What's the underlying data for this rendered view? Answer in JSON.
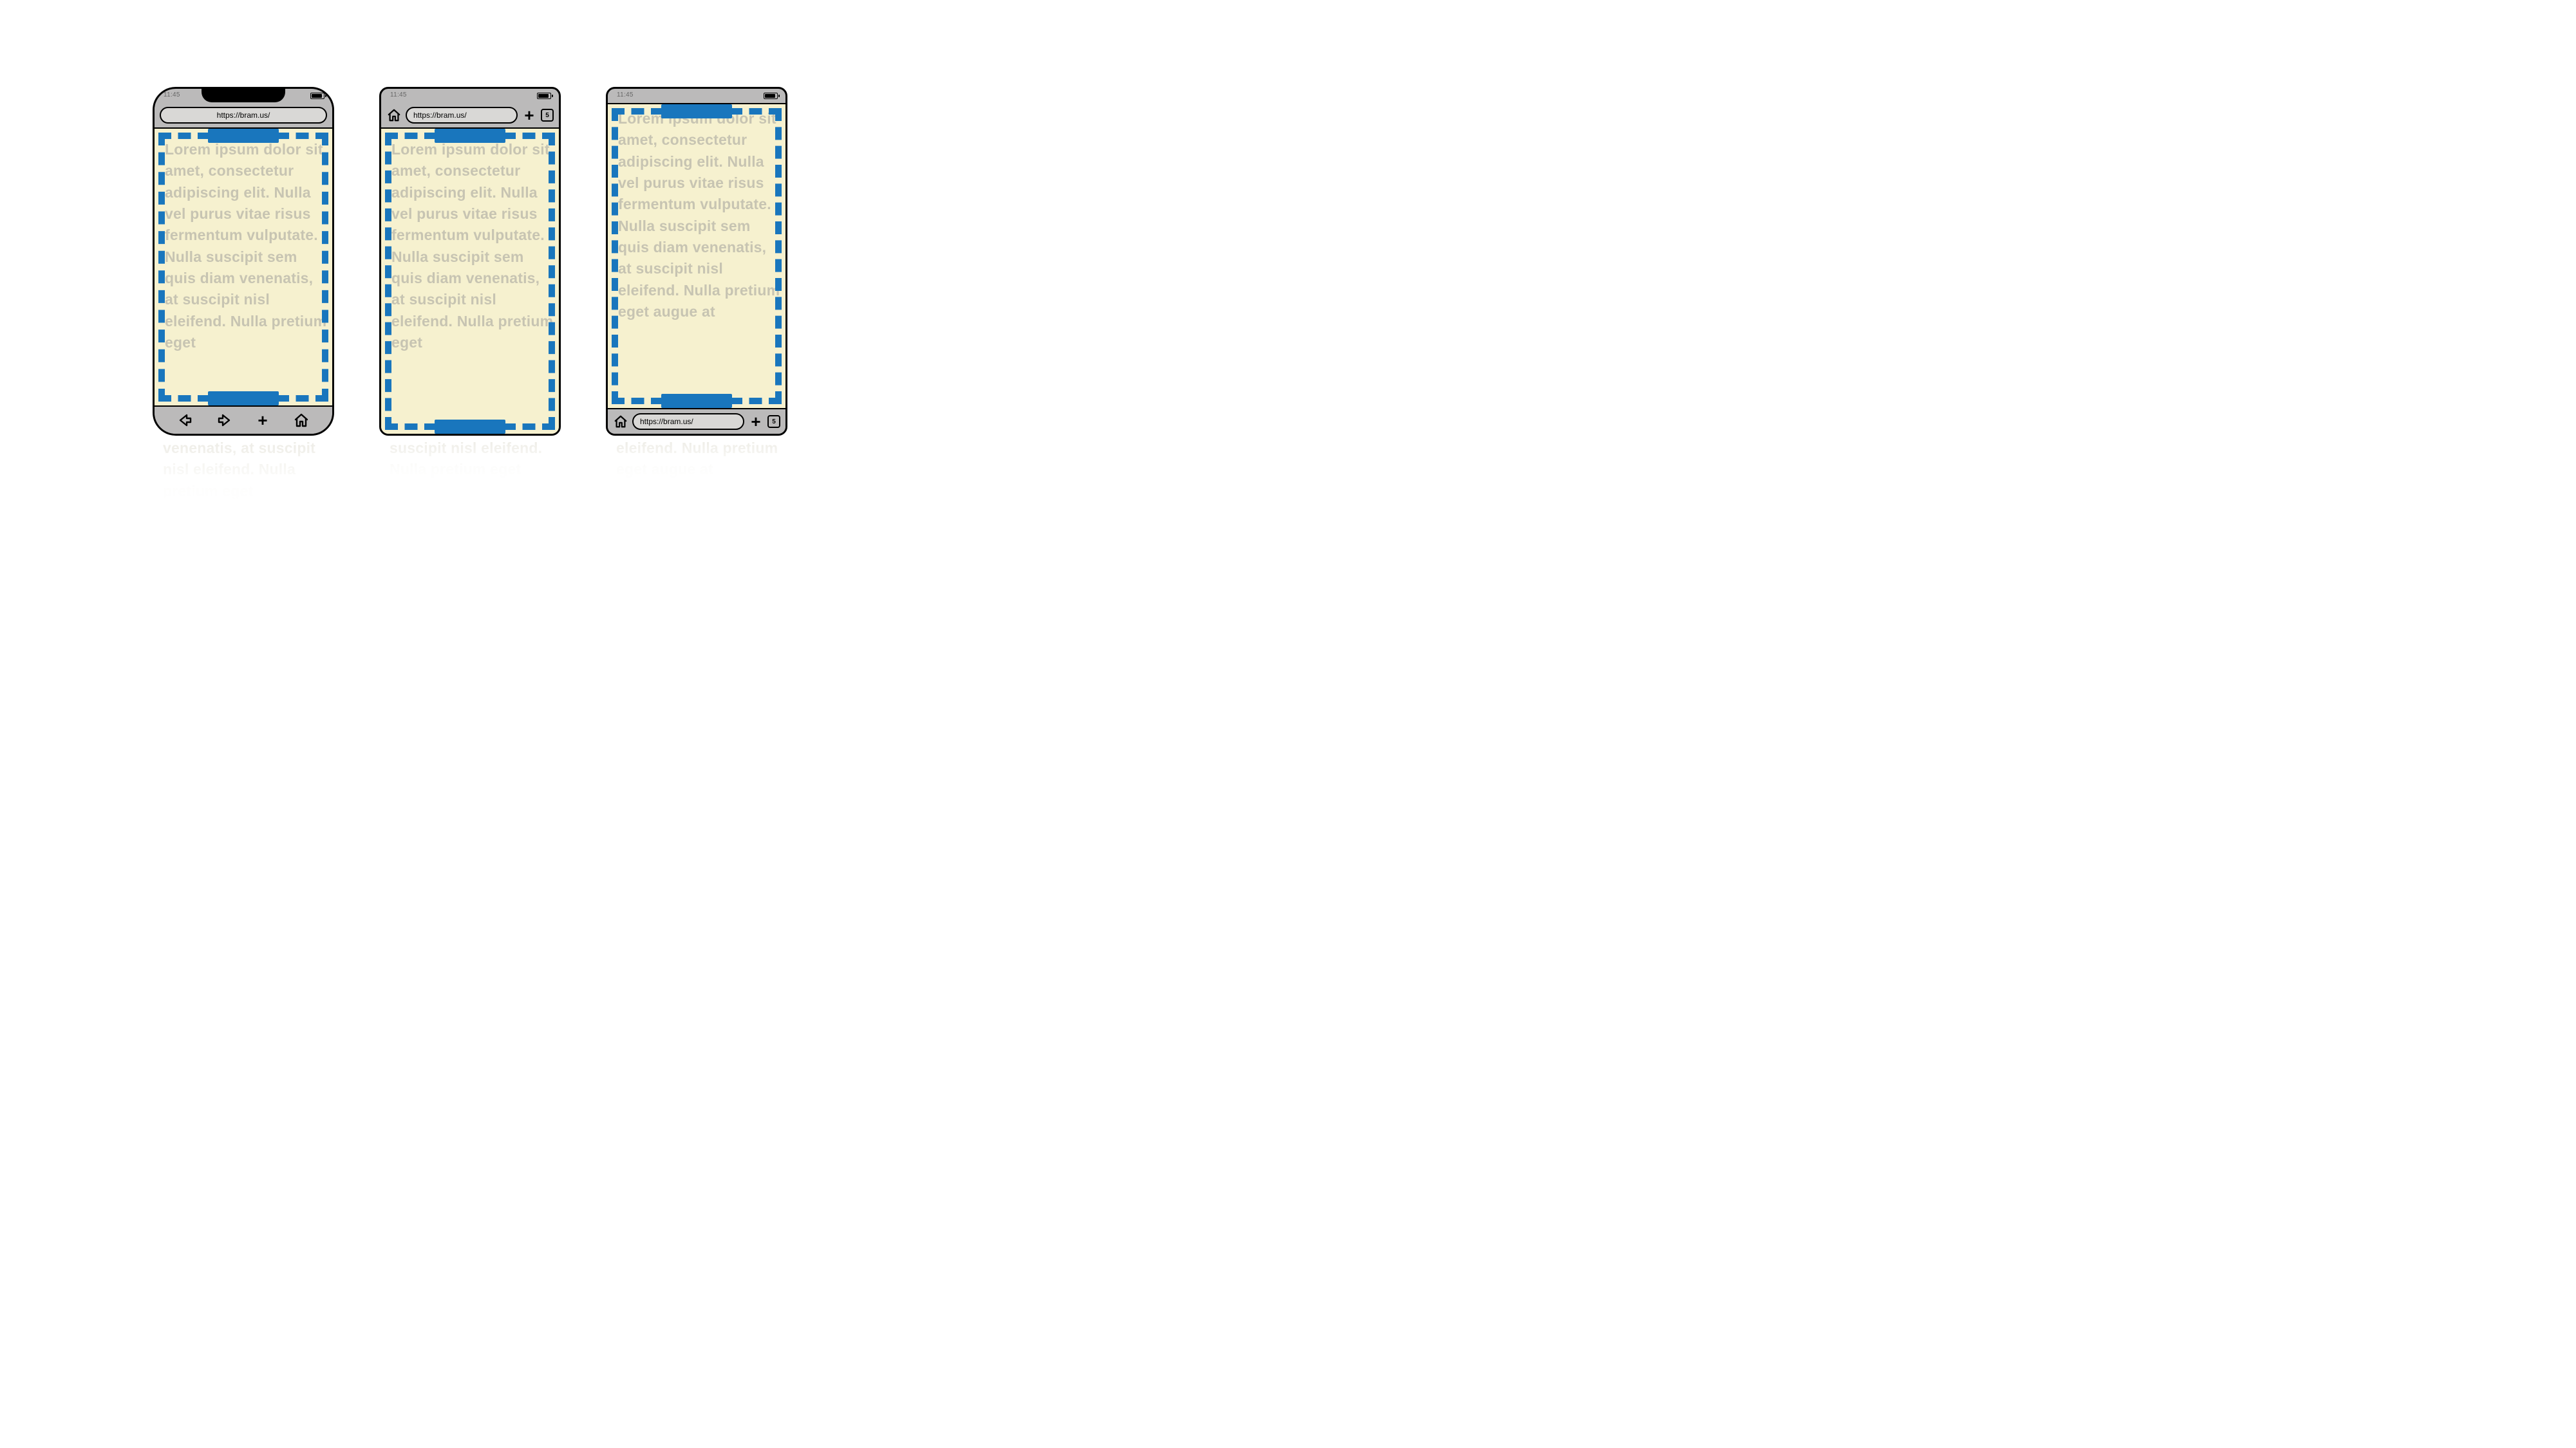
{
  "status": {
    "time": "11:45"
  },
  "url": "https://bram.us/",
  "tab_count": "5",
  "lorem_main": "Lorem ipsum dolor sit amet, consectetur adipiscing elit. Nulla vel purus vitae risus fermentum vulputate. Nulla suscipit sem quis diam venenatis, at suscipit nisl eleifend. Nulla pretium eget",
  "lorem_tall": "Lorem ipsum dolor sit amet, consectetur adipiscing elit. Nulla vel purus vitae risus fermentum vulputate. Nulla suscipit sem quis diam venenatis, at suscipit nisl eleifend. Nulla pretium eget augue at",
  "reflection": "venenatis, at suscipit nisl eleifend. Nulla pretium eget",
  "reflection2": "suscipit nisl eleifend. Nulla pretium eget",
  "reflection3": "eleifend. Nulla pretium eget augue at"
}
